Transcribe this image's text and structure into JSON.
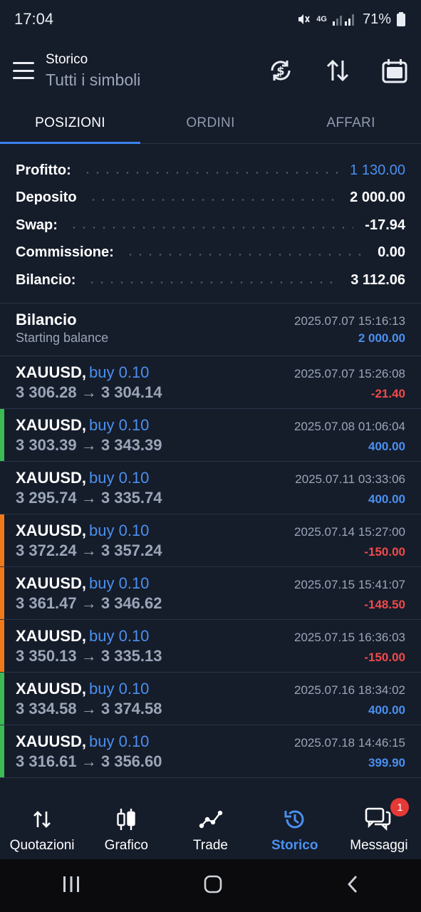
{
  "status_bar": {
    "time": "17:04",
    "battery": "71%",
    "network": "4G"
  },
  "header": {
    "title": "Storico",
    "subtitle": "Tutti i simboli"
  },
  "tabs": [
    {
      "label": "POSIZIONI",
      "active": true
    },
    {
      "label": "ORDINI",
      "active": false
    },
    {
      "label": "AFFARI",
      "active": false
    }
  ],
  "summary": {
    "profit_label": "Profitto:",
    "profit_value": "1 130.00",
    "deposit_label": "Deposito",
    "deposit_value": "2 000.00",
    "swap_label": "Swap:",
    "swap_value": "-17.94",
    "commission_label": "Commissione:",
    "commission_value": "0.00",
    "balance_label": "Bilancio:",
    "balance_value": "3 112.06"
  },
  "balance_entry": {
    "title": "Bilancio",
    "subtitle": "Starting balance",
    "datetime": "2025.07.07 15:16:13",
    "amount": "2 000.00"
  },
  "positions": [
    {
      "symbol": "XAUUSD,",
      "side": "buy 0.10",
      "prices": "3 306.28 → 3 304.14",
      "datetime": "2025.07.07 15:26:08",
      "profit": "-21.40",
      "sign": "neg",
      "bar": "none"
    },
    {
      "symbol": "XAUUSD,",
      "side": "buy 0.10",
      "prices": "3 303.39 → 3 343.39",
      "datetime": "2025.07.08 01:06:04",
      "profit": "400.00",
      "sign": "pos",
      "bar": "green"
    },
    {
      "symbol": "XAUUSD,",
      "side": "buy 0.10",
      "prices": "3 295.74 → 3 335.74",
      "datetime": "2025.07.11 03:33:06",
      "profit": "400.00",
      "sign": "pos",
      "bar": "none"
    },
    {
      "symbol": "XAUUSD,",
      "side": "buy 0.10",
      "prices": "3 372.24 → 3 357.24",
      "datetime": "2025.07.14 15:27:00",
      "profit": "-150.00",
      "sign": "neg",
      "bar": "orange"
    },
    {
      "symbol": "XAUUSD,",
      "side": "buy 0.10",
      "prices": "3 361.47 → 3 346.62",
      "datetime": "2025.07.15 15:41:07",
      "profit": "-148.50",
      "sign": "neg",
      "bar": "orange"
    },
    {
      "symbol": "XAUUSD,",
      "side": "buy 0.10",
      "prices": "3 350.13 → 3 335.13",
      "datetime": "2025.07.15 16:36:03",
      "profit": "-150.00",
      "sign": "neg",
      "bar": "orange"
    },
    {
      "symbol": "XAUUSD,",
      "side": "buy 0.10",
      "prices": "3 334.58 → 3 374.58",
      "datetime": "2025.07.16 18:34:02",
      "profit": "400.00",
      "sign": "pos",
      "bar": "green"
    },
    {
      "symbol": "XAUUSD,",
      "side": "buy 0.10",
      "prices": "3 316.61 → 3 356.60",
      "datetime": "2025.07.18 14:46:15",
      "profit": "399.90",
      "sign": "pos",
      "bar": "green"
    }
  ],
  "bottom_nav": [
    {
      "label": "Quotazioni",
      "icon": "quotes-icon",
      "active": false
    },
    {
      "label": "Grafico",
      "icon": "chart-icon",
      "active": false
    },
    {
      "label": "Trade",
      "icon": "trade-icon",
      "active": false
    },
    {
      "label": "Storico",
      "icon": "history-icon",
      "active": true
    },
    {
      "label": "Messaggi",
      "icon": "messages-icon",
      "active": false,
      "badge": "1"
    }
  ],
  "colors": {
    "background": "#151c2a",
    "accent": "#4a90f0",
    "negative": "#f04a4a",
    "bar_green": "#3cba54",
    "bar_orange": "#f07a1a"
  }
}
